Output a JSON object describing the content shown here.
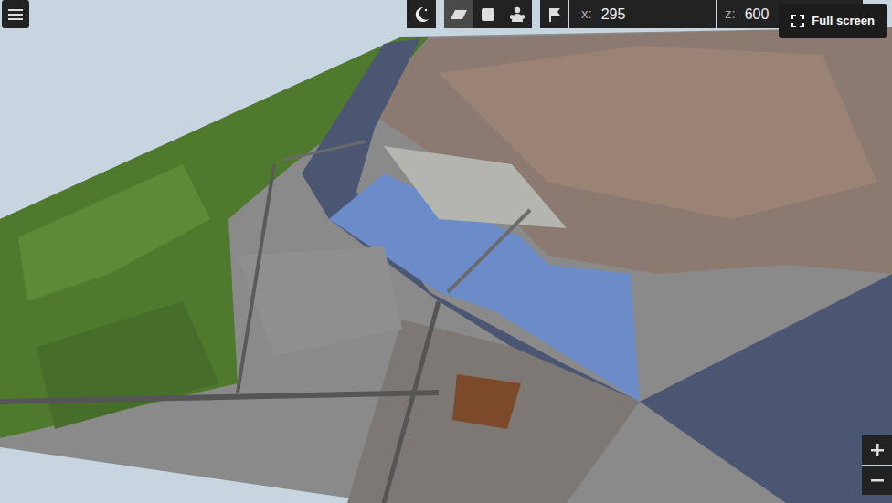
{
  "camera_modes": [
    {
      "kind": "perspective",
      "selected": true
    },
    {
      "kind": "flat",
      "selected": false
    },
    {
      "kind": "free",
      "selected": false
    }
  ],
  "position": {
    "x_label": "x:",
    "x": "295",
    "z_label": "z:",
    "z": "600"
  },
  "fullscreen_button": {
    "label": "Full screen"
  }
}
